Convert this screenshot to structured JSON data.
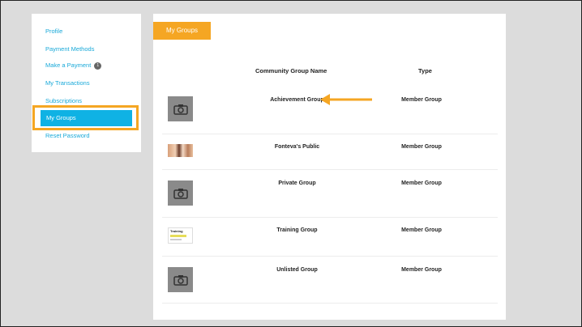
{
  "sidebar": {
    "items": [
      {
        "label": "Profile"
      },
      {
        "label": "Payment Methods"
      },
      {
        "label": "Make a Payment",
        "badge": "1"
      },
      {
        "label": "My Transactions"
      },
      {
        "label": "Subscriptions"
      },
      {
        "label": "My Groups",
        "active": true
      },
      {
        "label": "Reset Password"
      }
    ]
  },
  "main": {
    "tab_label": "My Groups",
    "columns": {
      "name": "Community Group Name",
      "type": "Type"
    },
    "rows": [
      {
        "name": "Achievement Group",
        "type": "Member Group",
        "thumbnail": "camera-icon"
      },
      {
        "name": "Fonteva's Public",
        "type": "Member Group",
        "thumbnail": "photo"
      },
      {
        "name": "Private Group",
        "type": "Member Group",
        "thumbnail": "camera-icon"
      },
      {
        "name": "Training Group",
        "type": "Member Group",
        "thumbnail": "training-image"
      },
      {
        "name": "Unlisted Group",
        "type": "Member Group",
        "thumbnail": "camera-icon"
      }
    ],
    "thumbnail_text": {
      "training": "Training"
    }
  },
  "colors": {
    "accent_orange": "#f5a623",
    "link_blue": "#19a9d9",
    "active_blue": "#0fb2e4"
  }
}
